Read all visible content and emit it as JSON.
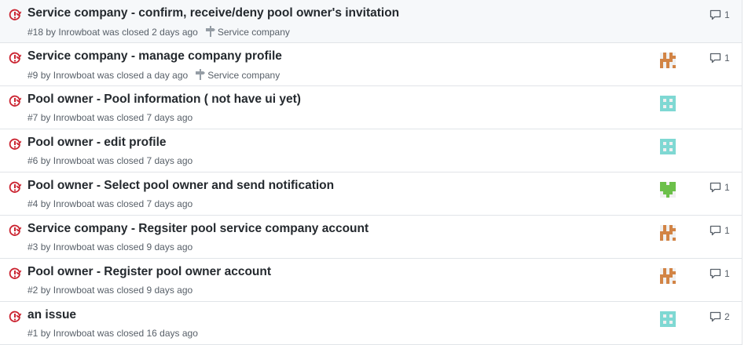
{
  "issues": [
    {
      "title": "Service company - confirm, receive/deny pool owner's invitation",
      "number": "#18",
      "by": "by",
      "author": "Inrowboat",
      "closed": "was closed 2 days ago",
      "milestone": "Service company",
      "avatar": "",
      "comments": "1"
    },
    {
      "title": "Service company - manage company profile",
      "number": "#9",
      "by": "by",
      "author": "Inrowboat",
      "closed": "was closed a day ago",
      "milestone": "Service company",
      "avatar": "orange",
      "comments": "1"
    },
    {
      "title": "Pool owner - Pool information ( not have ui yet)",
      "number": "#7",
      "by": "by",
      "author": "Inrowboat",
      "closed": "was closed 7 days ago",
      "milestone": "",
      "avatar": "teal",
      "comments": ""
    },
    {
      "title": "Pool owner - edit profile",
      "number": "#6",
      "by": "by",
      "author": "Inrowboat",
      "closed": "was closed 7 days ago",
      "milestone": "",
      "avatar": "teal",
      "comments": ""
    },
    {
      "title": "Pool owner - Select pool owner and send notification",
      "number": "#4",
      "by": "by",
      "author": "Inrowboat",
      "closed": "was closed 7 days ago",
      "milestone": "",
      "avatar": "green",
      "comments": "1"
    },
    {
      "title": "Service company - Regsiter pool service company account",
      "number": "#3",
      "by": "by",
      "author": "Inrowboat",
      "closed": "was closed 9 days ago",
      "milestone": "",
      "avatar": "orange",
      "comments": "1"
    },
    {
      "title": "Pool owner - Register pool owner account",
      "number": "#2",
      "by": "by",
      "author": "Inrowboat",
      "closed": "was closed 9 days ago",
      "milestone": "",
      "avatar": "orange",
      "comments": "1"
    },
    {
      "title": "an issue",
      "number": "#1",
      "by": "by",
      "author": "Inrowboat",
      "closed": "was closed 16 days ago",
      "milestone": "",
      "avatar": "teal",
      "comments": "2"
    }
  ],
  "icons": {
    "status": "issue-closed-icon",
    "milestone": "milestone-icon",
    "comments": "comment-icon",
    "avatar": "identicon-avatar"
  },
  "colors": {
    "closed": "#cb2431",
    "orange": "#d28445",
    "teal": "#7fd8d3",
    "green": "#6cc04a",
    "muted": "#586069",
    "title": "#24292e",
    "border": "#e1e4e8"
  }
}
